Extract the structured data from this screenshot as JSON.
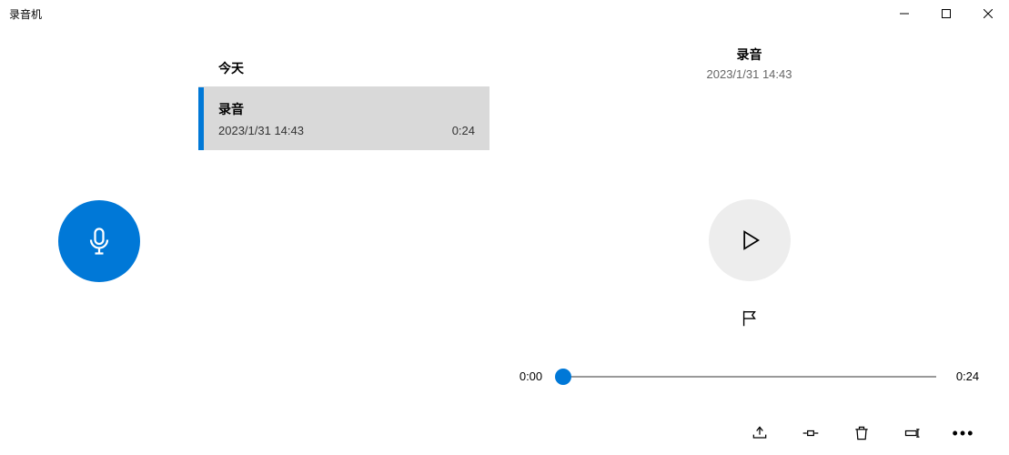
{
  "window": {
    "title": "录音机"
  },
  "sidebar": {
    "record": "record"
  },
  "list": {
    "section": "今天",
    "items": [
      {
        "title": "录音",
        "date": "2023/1/31 14:43",
        "duration": "0:24"
      }
    ]
  },
  "player": {
    "title": "录音",
    "date": "2023/1/31 14:43",
    "current_time": "0:00",
    "total_time": "0:24"
  },
  "icons": {
    "minimize": "minimize",
    "maximize": "maximize",
    "close": "close",
    "mic": "mic",
    "play": "play",
    "flag": "flag",
    "share": "share",
    "trim": "trim",
    "delete": "delete",
    "rename": "rename",
    "more": "more"
  }
}
